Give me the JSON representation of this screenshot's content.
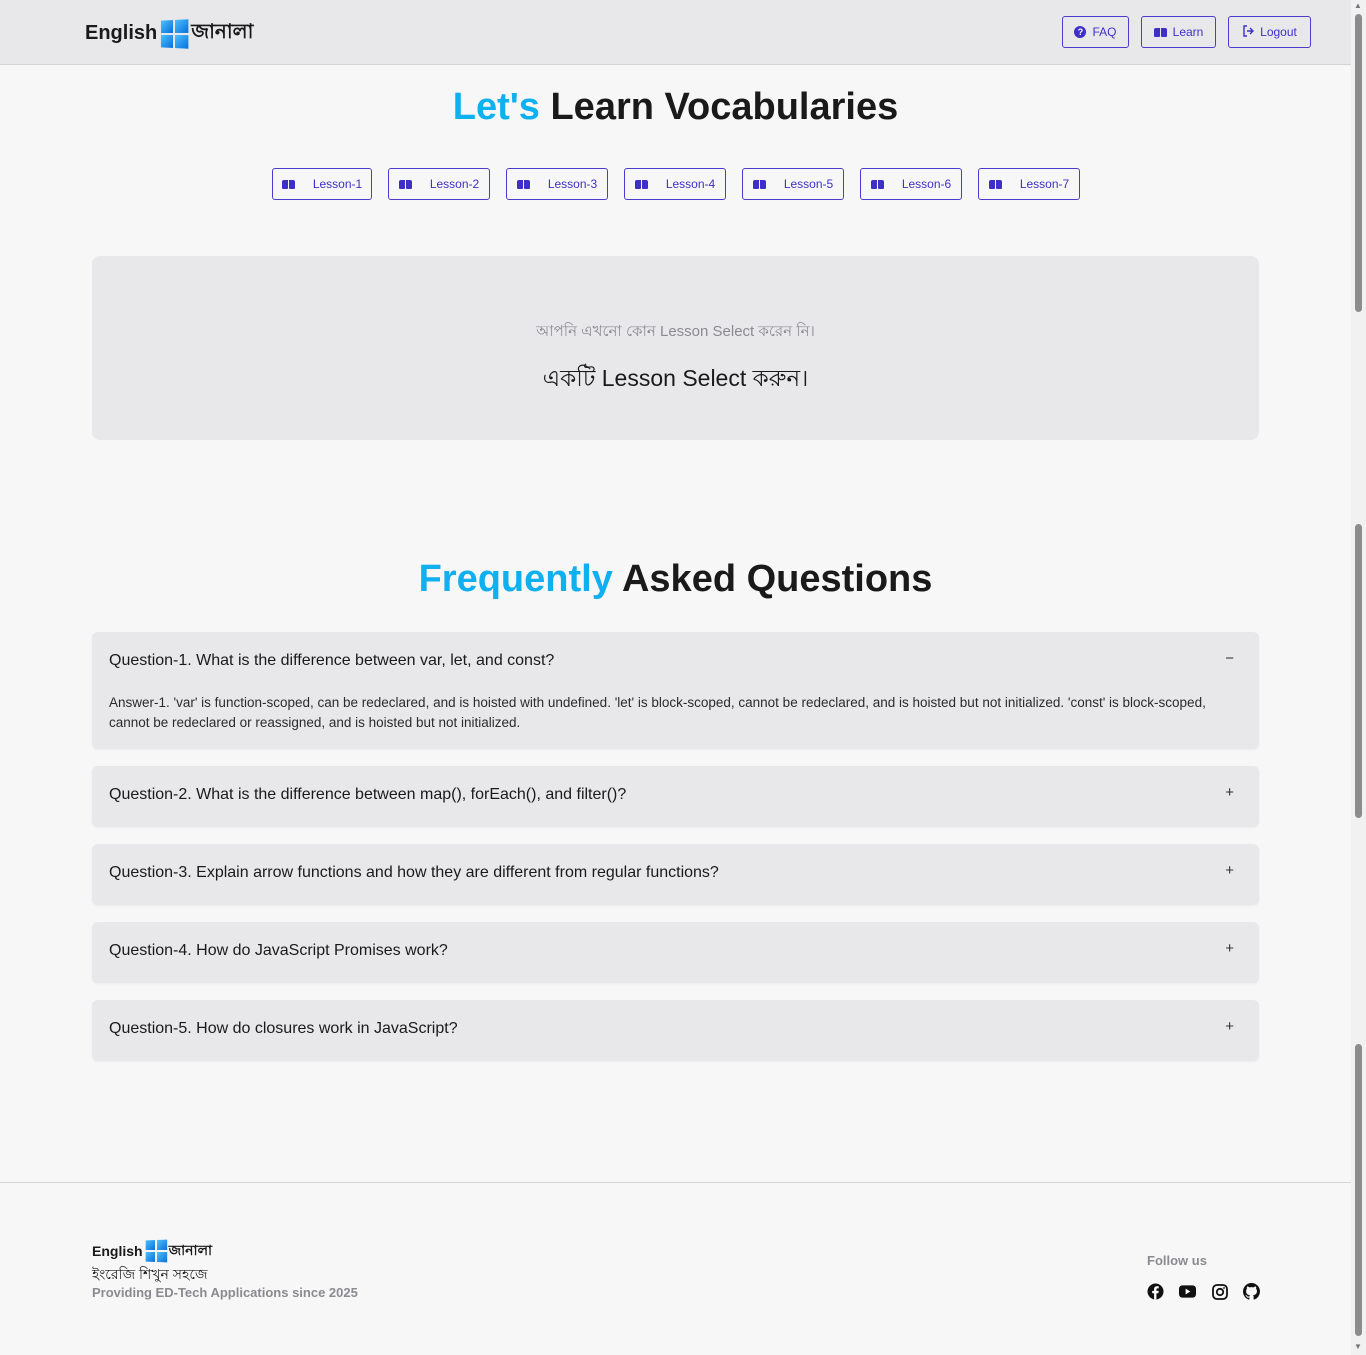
{
  "navbar": {
    "logo_en": "English",
    "logo_bn": "জানালা",
    "faq_label": "FAQ",
    "learn_label": "Learn",
    "logout_label": "Logout"
  },
  "vocab": {
    "title_accent": "Let's",
    "title_rest": "Learn Vocabularies",
    "lessons": [
      "Lesson-1",
      "Lesson-2",
      "Lesson-3",
      "Lesson-4",
      "Lesson-5",
      "Lesson-6",
      "Lesson-7"
    ],
    "empty_sub": "আপনি এখনো কোন Lesson Select করেন নি।",
    "empty_main": "একটি Lesson Select করুন।"
  },
  "faq": {
    "title_accent": "Frequently",
    "title_rest": "Asked Questions",
    "items": [
      {
        "question": "Question-1. What is the difference between var, let, and const?",
        "answer": "Answer-1. 'var' is function-scoped, can be redeclared, and is hoisted with undefined. 'let' is block-scoped, cannot be redeclared, and is hoisted but not initialized. 'const' is block-scoped, cannot be redeclared or reassigned, and is hoisted but not initialized.",
        "toggle": "−"
      },
      {
        "question": "Question-2. What is the difference between map(), forEach(), and filter()?",
        "toggle": "+"
      },
      {
        "question": "Question-3. Explain arrow functions and how they are different from regular functions?",
        "toggle": "+"
      },
      {
        "question": "Question-4. How do JavaScript Promises work?",
        "toggle": "+"
      },
      {
        "question": "Question-5. How do closures work in JavaScript?",
        "toggle": "+"
      }
    ]
  },
  "footer": {
    "logo_en": "English",
    "logo_bn": "জানালা",
    "tagline": "ইংরেজি শিখুন সহজে",
    "since": "Providing ED-Tech Applications since 2025",
    "follow_label": "Follow us",
    "social_icons": [
      "facebook-icon",
      "youtube-icon",
      "instagram-icon",
      "github-icon"
    ]
  },
  "colors": {
    "accent": "#0fb0ef",
    "primary": "#3d2fc8"
  }
}
